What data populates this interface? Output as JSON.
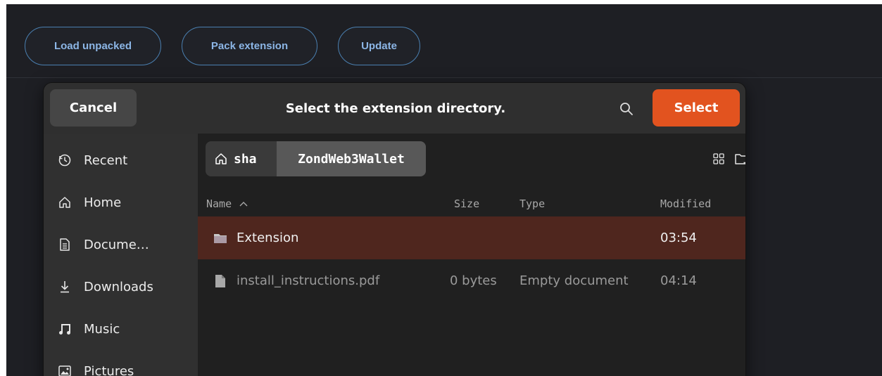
{
  "toolbar": {
    "load_unpacked": "Load unpacked",
    "pack_extension": "Pack extension",
    "update": "Update"
  },
  "dialog": {
    "cancel_label": "Cancel",
    "title": "Select the extension directory.",
    "select_label": "Select",
    "search_icon": "search-icon"
  },
  "sidebar": {
    "items": [
      {
        "label": "Recent",
        "icon": "clock-icon"
      },
      {
        "label": "Home",
        "icon": "home-icon"
      },
      {
        "label": "Docume…",
        "icon": "document-icon"
      },
      {
        "label": "Downloads",
        "icon": "download-icon"
      },
      {
        "label": "Music",
        "icon": "music-icon"
      },
      {
        "label": "Pictures",
        "icon": "picture-icon"
      }
    ]
  },
  "pathbar": {
    "home_label": "sha",
    "current_label": "ZondWeb3Wallet"
  },
  "columns": {
    "name": "Name",
    "size": "Size",
    "type": "Type",
    "modified": "Modified"
  },
  "files": [
    {
      "name": "Extension",
      "size": "",
      "type": "",
      "modified": "03:54",
      "kind": "folder",
      "selected": true
    },
    {
      "name": "install_instructions.pdf",
      "size": "0 bytes",
      "type": "Empty document",
      "modified": "04:14",
      "kind": "file",
      "selected": false
    }
  ],
  "colors": {
    "accent": "#e2531f",
    "selected_row": "#4f261e",
    "toolbar_button_text": "#8cb6e6"
  }
}
